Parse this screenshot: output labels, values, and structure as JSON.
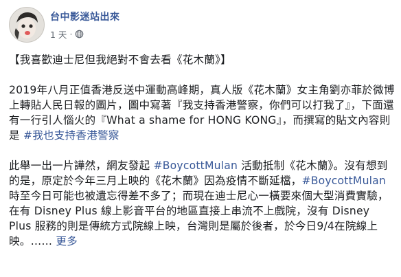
{
  "post": {
    "author": "台中影迷站出來",
    "time": "1 天",
    "separator": "·",
    "privacy_icon": "globe-icon",
    "paragraphs": [
      [
        {
          "t": "【我喜歡迪士尼但我絕對不會去看《花木蘭》】"
        }
      ],
      [
        {
          "t": "2019年八月正值香港反送中運動高峰期，真人版《花木蘭》女主角劉亦菲於微博上轉貼人民日報的圖片，圖中寫著『我支持香港警察，你們可以打我了』，下面還有一行引人惱火的『What a shame for HONG KONG』，而撰寫的貼文內容則是 "
        },
        {
          "t": "#我也支持香港警察",
          "tag": true
        }
      ],
      [
        {
          "t": "此舉一出一片譁然，網友發起 "
        },
        {
          "t": "#BoycottMulan",
          "tag": true
        },
        {
          "t": " 活動抵制《花木蘭》。沒有想到的是，原定於今年三月上映的《花木蘭》因為疫情不斷延檔，"
        },
        {
          "t": "#BoycottMulan",
          "tag": true
        },
        {
          "t": " 時至今日可能也被遺忘得差不多了；而現在迪士尼心一橫要來個大型消費實驗，在有 Disney Plus 線上影音平台的地區直接上串流不上戲院，沒有 Disney Plus 服務的則是傳統方式院線上映，台灣則是屬於後者，於今日9/4在院線上映。……"
        },
        {
          "t": " 更多",
          "more": true
        }
      ]
    ]
  }
}
